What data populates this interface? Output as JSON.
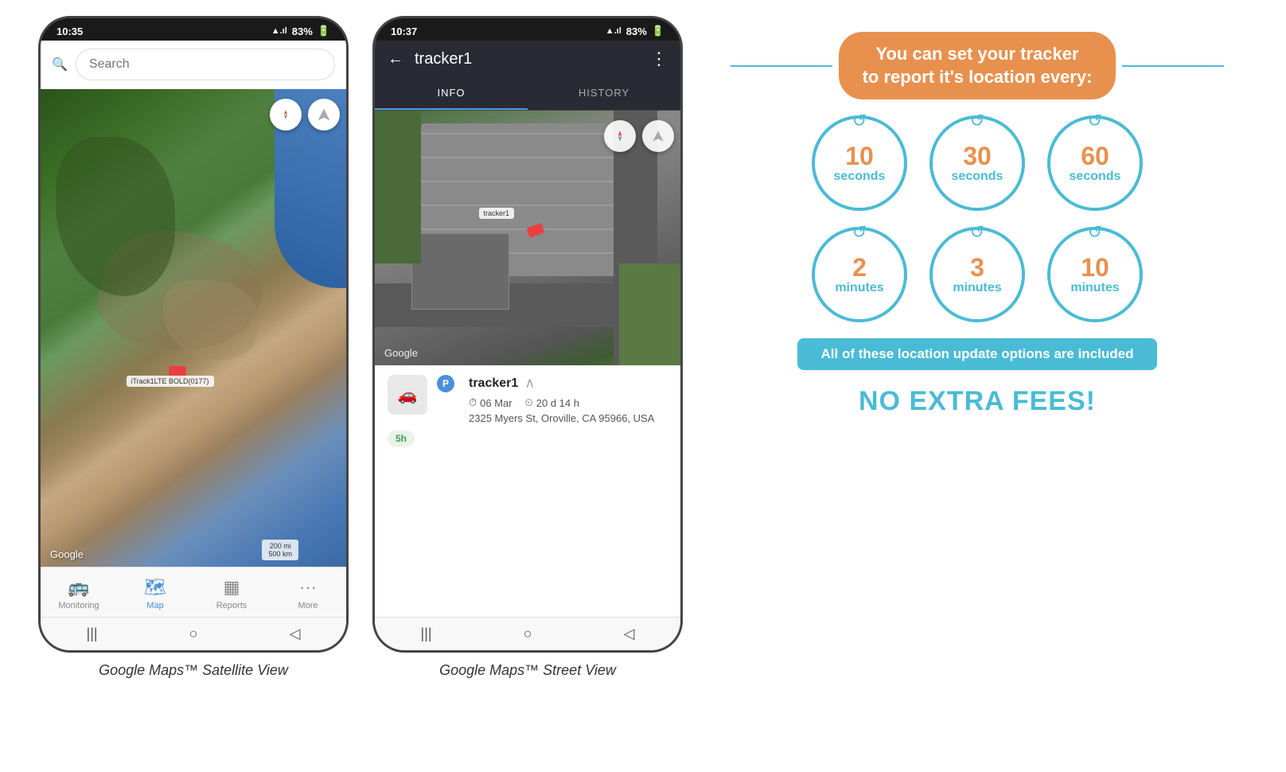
{
  "phone1": {
    "status": {
      "time": "10:35",
      "signal": "◼◼◼",
      "wifi": "▲",
      "battery": "83%"
    },
    "search": {
      "placeholder": "Search"
    },
    "map": {
      "google_label": "Google",
      "scale_label": "200 mi\n500 km",
      "tracker_label": "iTrack1LTE BOLD(0177)"
    },
    "nav": {
      "items": [
        {
          "id": "monitoring",
          "label": "Monitoring",
          "icon": "🚌"
        },
        {
          "id": "map",
          "label": "Map",
          "icon": "🗺",
          "active": true
        },
        {
          "id": "reports",
          "label": "Reports",
          "icon": "▦"
        },
        {
          "id": "more",
          "label": "More",
          "icon": "···"
        }
      ]
    },
    "caption": "Google Maps™ Satellite View"
  },
  "phone2": {
    "status": {
      "time": "10:37",
      "signal": "◼◼◼",
      "wifi": "▲",
      "battery": "83%"
    },
    "header": {
      "title": "tracker1",
      "back_icon": "←",
      "menu_icon": "⋮"
    },
    "tabs": [
      {
        "id": "info",
        "label": "INFO",
        "active": true
      },
      {
        "id": "history",
        "label": "HISTORY"
      }
    ],
    "map": {
      "google_label": "Google",
      "tracker_label": "tracker1"
    },
    "tracker": {
      "name": "tracker1",
      "date": "06 Mar",
      "duration": "20 d 14 h",
      "address": "2325 Myers St, Oroville, CA 95966, USA",
      "badge": "5h"
    },
    "caption": "Google Maps™ Street View"
  },
  "infographic": {
    "headline": "You can set your tracker\nto report it's location every:",
    "circles": [
      {
        "num": "10",
        "unit": "seconds"
      },
      {
        "num": "30",
        "unit": "seconds"
      },
      {
        "num": "60",
        "unit": "seconds"
      },
      {
        "num": "2",
        "unit": "minutes"
      },
      {
        "num": "3",
        "unit": "minutes"
      },
      {
        "num": "10",
        "unit": "minutes"
      }
    ],
    "footer_banner": "All of these location update options are included",
    "no_fees": "NO EXTRA FEES!"
  }
}
